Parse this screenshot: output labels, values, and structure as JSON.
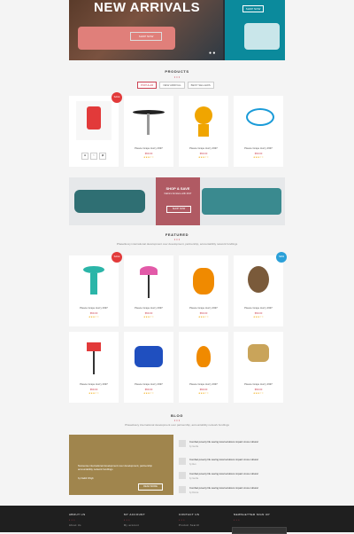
{
  "hero": {
    "title": "NEW ARRIVALS",
    "shop_btn": "SHOP NOW",
    "side_btn": "SHOP NOW"
  },
  "products": {
    "title": "PRODUCTS",
    "tabs": [
      "POPULAR",
      "NEW ARRIVAL",
      "BEST SELLERS"
    ],
    "items": [
      {
        "name": "Pleace Grape Hurry 2997",
        "price": "$59.00",
        "rating": "★★★☆☆",
        "badge": "SALE",
        "badge_color": "#e23a3a"
      },
      {
        "name": "Pleace Grape Hurry 2997",
        "price": "$59.00",
        "rating": "★★★☆☆"
      },
      {
        "name": "Pleace Grape Hurry 2997",
        "price": "$59.00",
        "rating": "★★★☆☆"
      },
      {
        "name": "Pleace Grape Hurry 2997",
        "price": "$59.00",
        "rating": "★★★☆☆"
      }
    ]
  },
  "banner": {
    "title": "SHOP & SAVE",
    "subtitle": "Fabrico furniture with 2017",
    "btn": "SHOP NOW"
  },
  "featured": {
    "title": "FEATURED",
    "subtitle": "Phasellusxy international development over development, partnership, accountability network fundlings",
    "items": [
      {
        "name": "Pleace Grape Hurry 2997",
        "price": "$59.00",
        "rating": "★★★☆☆",
        "badge": "SALE",
        "badge_color": "#e23a3a"
      },
      {
        "name": "Pleace Grape Hurry 2997",
        "price": "$59.00",
        "rating": "★★★☆☆"
      },
      {
        "name": "Pleace Grape Hurry 2997",
        "price": "$59.00",
        "rating": "★★★☆☆"
      },
      {
        "name": "Pleace Grape Hurry 2997",
        "price": "$59.00",
        "rating": "★★★☆☆",
        "badge": "NEW",
        "badge_color": "#2ba0d8"
      },
      {
        "name": "Pleace Grape Hurry 2997",
        "price": "$59.00",
        "rating": "★★★☆☆"
      },
      {
        "name": "Pleace Grape Hurry 2997",
        "price": "$59.00",
        "rating": "★★★☆☆"
      },
      {
        "name": "Pleace Grape Hurry 2997",
        "price": "$59.00",
        "rating": "★★★☆☆"
      },
      {
        "name": "Pleace Grape Hurry 2997",
        "price": "$59.00",
        "rating": "★★★☆☆"
      }
    ]
  },
  "blog": {
    "title": "BLOG",
    "subtitle": "Phasellusxy international development over partnership, accountability network fundlings",
    "main_title": "Nonsense international development over development, partnership accountability network fundlings",
    "main_by": "by Nadid Dhigh",
    "read_more": "READ MORE",
    "posts": [
      {
        "title": "Combat poverty life saving local solutions impact cross cultural",
        "by": "by Gentle"
      },
      {
        "title": "Combat poverty life saving local solutions impact cross cultural",
        "by": "by Alex"
      },
      {
        "title": "Combat poverty life saving local solutions impact cross cultural",
        "by": "by Gentle"
      },
      {
        "title": "Combat poverty life saving local solutions impact cross cultural",
        "by": "by Donna"
      }
    ]
  },
  "footer": {
    "cols": [
      {
        "title": "ABOUT US",
        "link": "About Us"
      },
      {
        "title": "MY ACCOUNT",
        "link": "My account"
      },
      {
        "title": "CONTACT US",
        "link": "Product Search"
      },
      {
        "title": "NEWSLETTER SIGN UP",
        "link": ""
      }
    ]
  }
}
